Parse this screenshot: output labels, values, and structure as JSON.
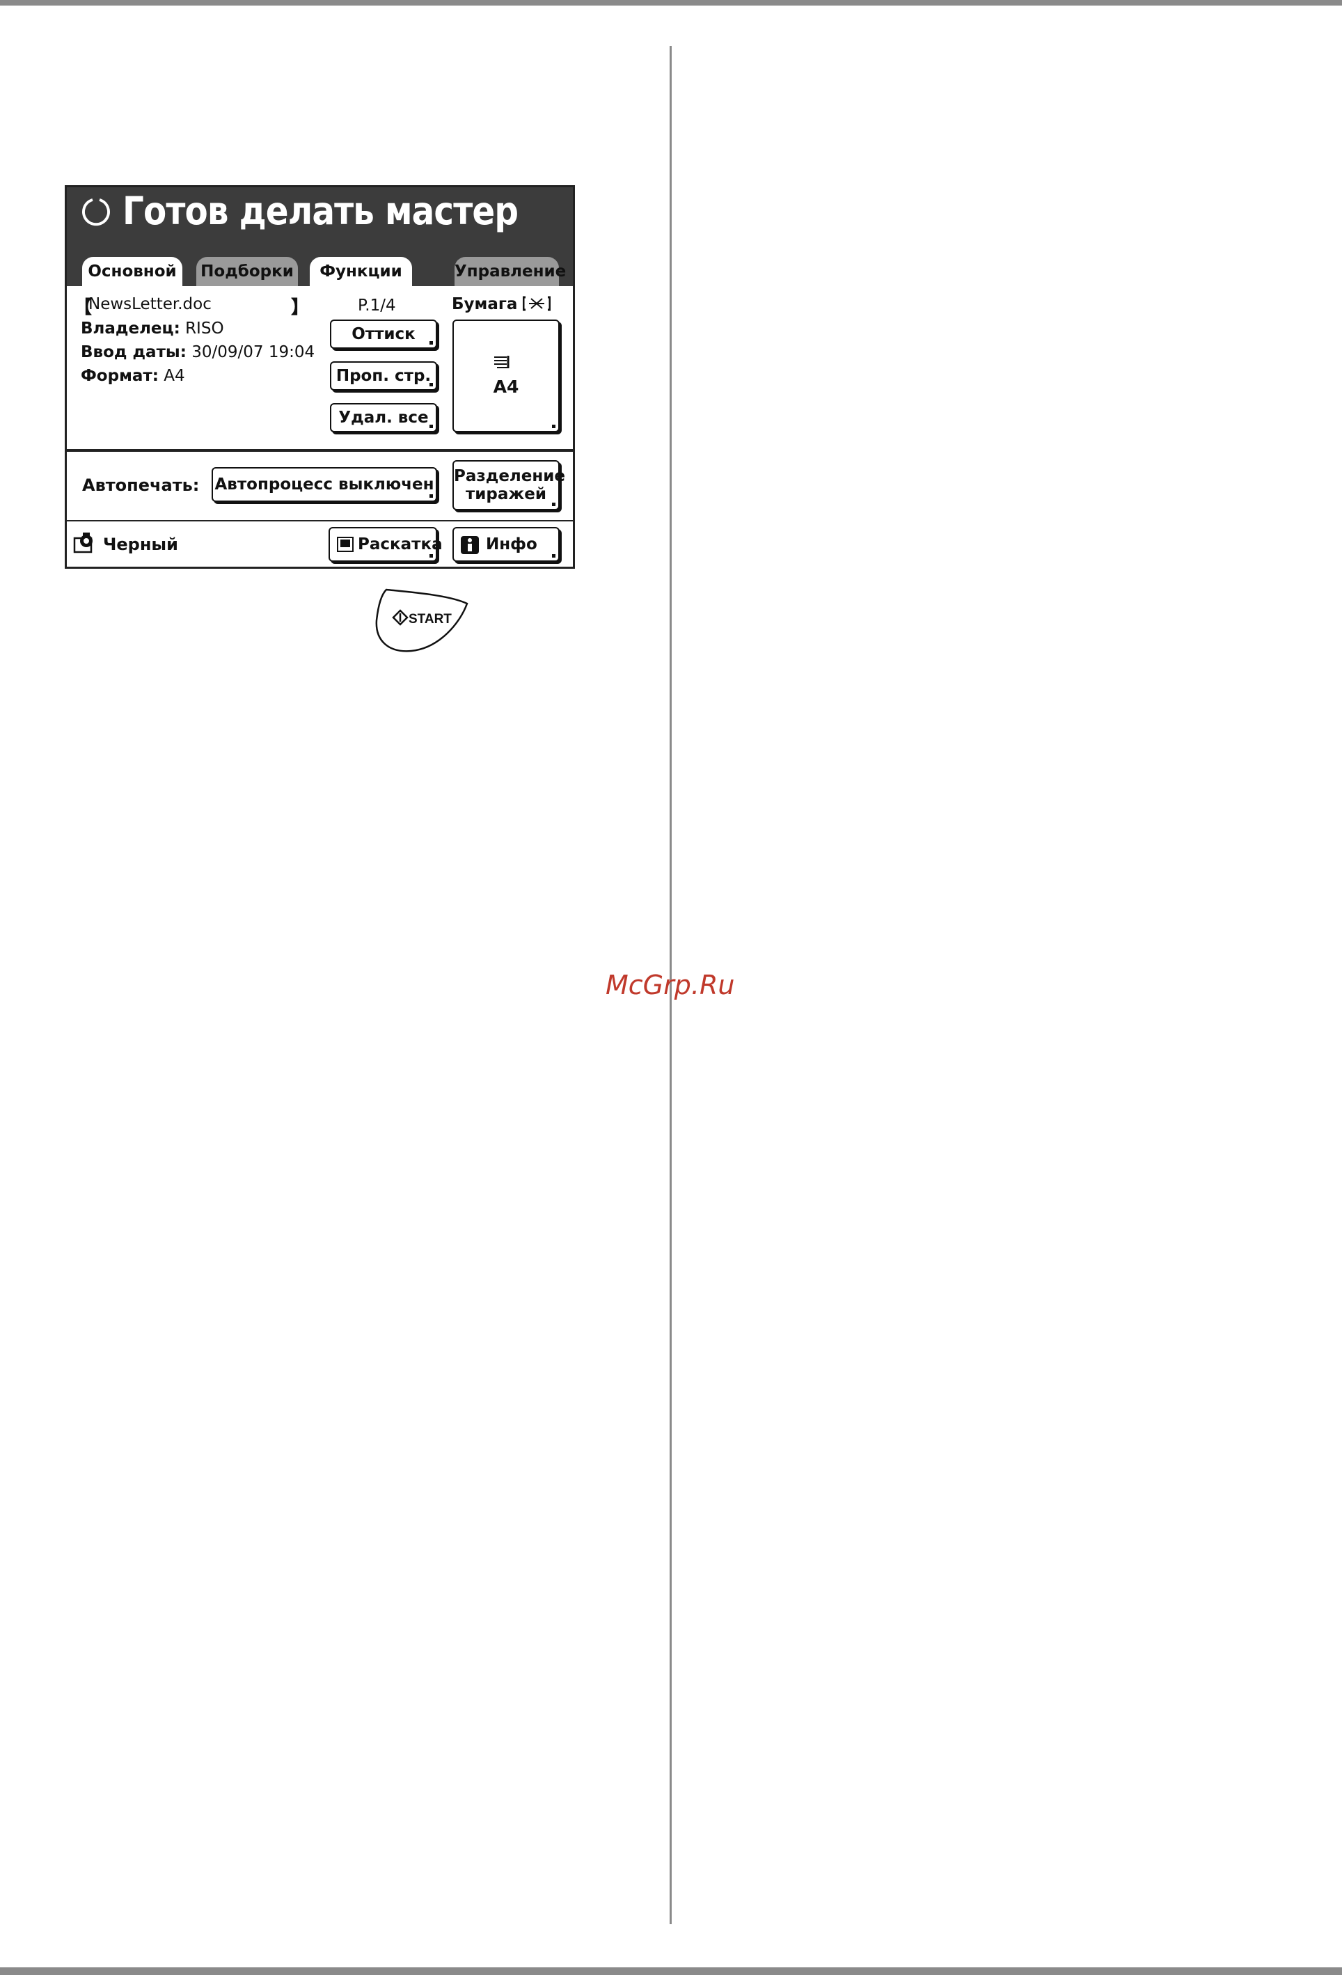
{
  "header": {
    "title": "Готов делать мастер"
  },
  "tabs": [
    {
      "label": "Основной",
      "active": true
    },
    {
      "label": "Подборки",
      "active": false
    },
    {
      "label": "Функции",
      "active": true
    },
    {
      "label": "Управление",
      "active": false
    }
  ],
  "document": {
    "bracket_open": "【",
    "filename": "NewsLetter.doc",
    "bracket_close": "】",
    "owner_label": "Владелец:",
    "owner_value": "RISO",
    "date_label": "Ввод даты:",
    "date_value": "30/09/07 19:04",
    "format_label": "Формат:",
    "format_value": "A4"
  },
  "pages": {
    "indicator": "P.1/4"
  },
  "buttons": {
    "proof": "Оттиск",
    "skip_page": "Проп. стр.",
    "delete_all": "Удал. все",
    "auto_process": "Автопроцесс выключен",
    "job_separation_line1": "Разделение",
    "job_separation_line2": "тиражей",
    "layout": "Раскатка",
    "info": "Инфо"
  },
  "paper": {
    "label": "Бумага",
    "size": "A4",
    "icon": "paper-tray-icon"
  },
  "auto_print": {
    "label": "Автопечать:"
  },
  "ink": {
    "label": "Черный",
    "icon": "ink-drum-icon"
  },
  "start_key": {
    "label": "START"
  },
  "watermark": {
    "text": "McGrp.Ru",
    "color": "#c0392b"
  },
  "colors": {
    "header_bg": "#3c3c3c",
    "inactive_tab": "#9a9a9a",
    "border": "#222222",
    "rule": "#8a8a8a"
  }
}
